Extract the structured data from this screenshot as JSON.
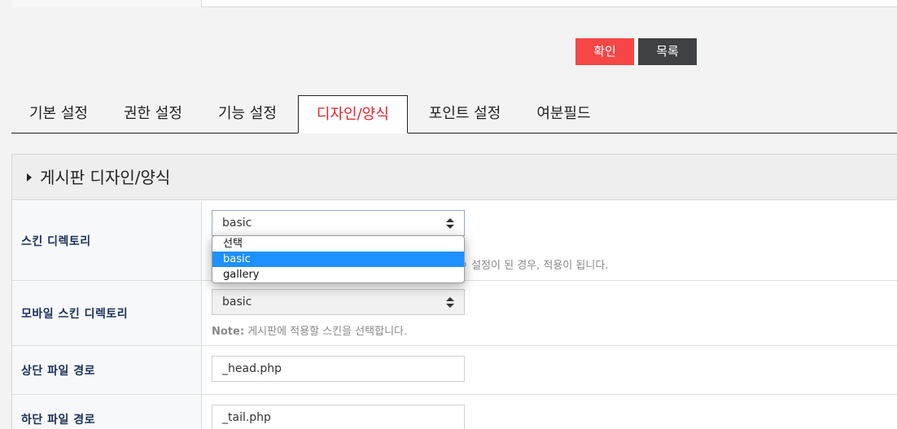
{
  "actions": {
    "confirm": "확인",
    "list": "목록"
  },
  "tabs": [
    {
      "label": "기본 설정"
    },
    {
      "label": "권한 설정"
    },
    {
      "label": "기능 설정"
    },
    {
      "label": "디자인/양식"
    },
    {
      "label": "포인트 설정"
    },
    {
      "label": "여분필드"
    }
  ],
  "active_tab": "디자인/양식",
  "section": {
    "title": "게시판 디자인/양식"
  },
  "fields": {
    "skin_dir": {
      "label": "스킨 디렉토리",
      "value": "basic",
      "note_partial": "ㅇ 설정이 된 경우, 적용이 됩니다."
    },
    "mobile_skin_dir": {
      "label": "모바일 스킨 디렉토리",
      "value": "basic",
      "note_prefix": "Note:",
      "note_text": "게시판에 적용할 스킨을 선택합니다."
    },
    "head_path": {
      "label": "상단 파일 경로",
      "value": "_head.php"
    },
    "tail_path": {
      "label": "하단 파일 경로",
      "value": "_tail.php"
    }
  },
  "dropdown": {
    "options": [
      "선택",
      "basic",
      "gallery"
    ],
    "selected": "basic",
    "highlight_color": "#1e90ff"
  },
  "colors": {
    "confirm_button": "#f64646",
    "list_button": "#3f4144",
    "active_tab_text": "#e8202a",
    "label_text": "#1b2f58"
  }
}
